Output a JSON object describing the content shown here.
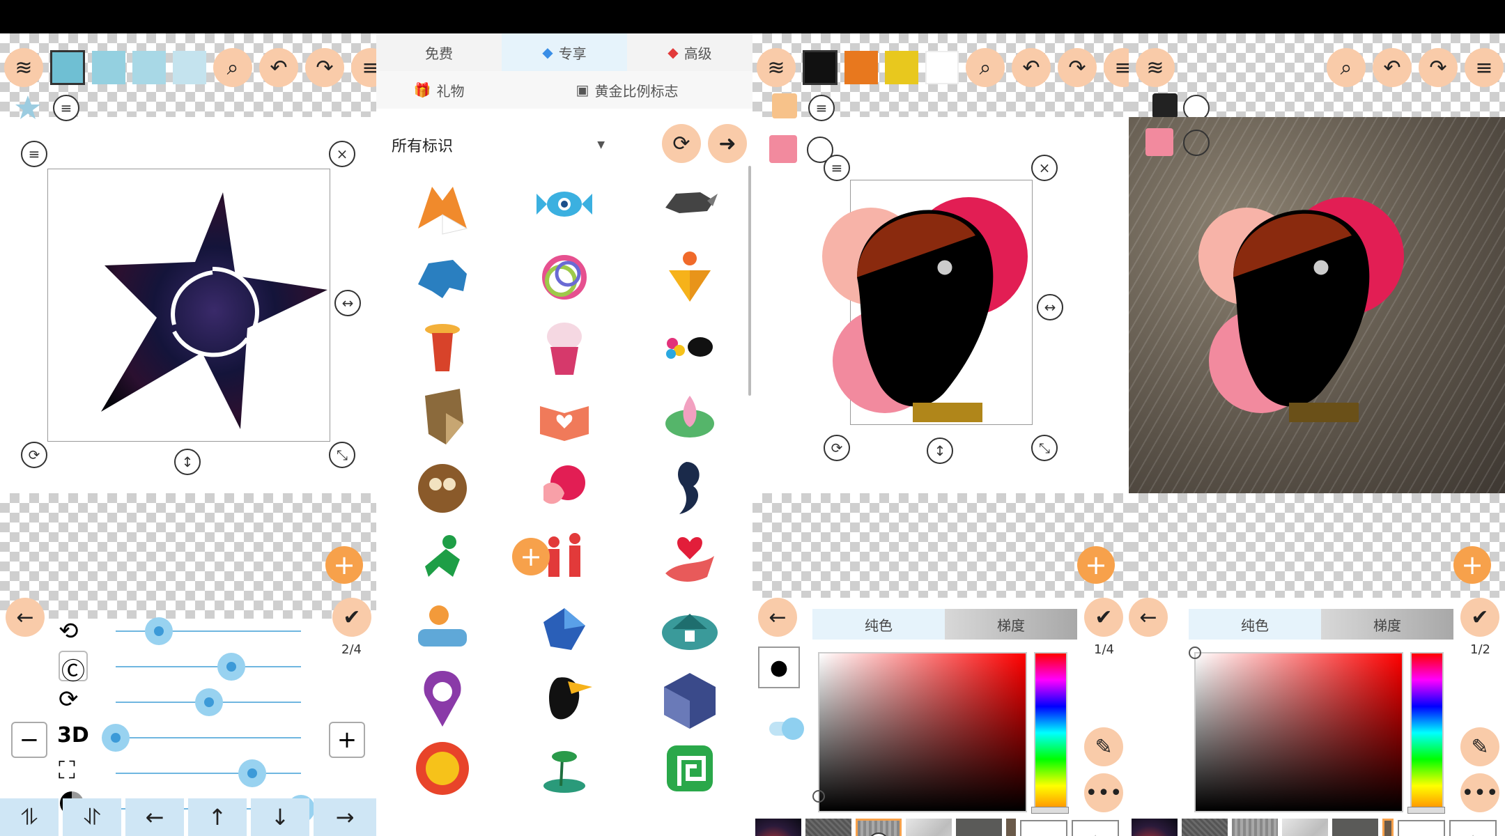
{
  "panel2": {
    "tabs": [
      "免费",
      "专享",
      "高级"
    ],
    "gift_label": "礼物",
    "golden_label": "黄金比例标志",
    "dropdown_label": "所有标识"
  },
  "panel1": {
    "three_d_label": "3D",
    "page_indicator": "2/4",
    "slider_levels": [
      0.25,
      0.62,
      0.5,
      0.0,
      0.73,
      1.0
    ]
  },
  "panel3": {
    "tab_solid": "纯色",
    "tab_gradient": "梯度",
    "page_indicator": "1/4"
  },
  "panel4": {
    "tab_solid": "纯色",
    "tab_gradient": "梯度",
    "page_indicator": "1/2"
  },
  "colors": {
    "accent_orange": "#f7a14b",
    "button_peach": "#f9cba9",
    "slider_blue": "#3c9ad8",
    "swatch_blue": "#6fbfd3"
  }
}
